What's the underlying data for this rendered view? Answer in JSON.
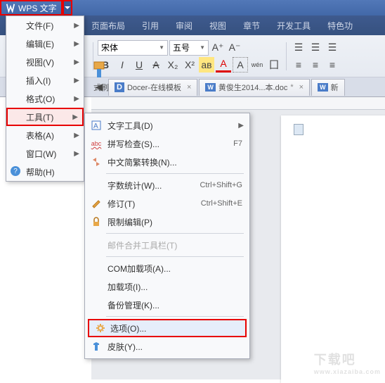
{
  "app": {
    "title": "WPS 文字"
  },
  "tabs": [
    "页面布局",
    "引用",
    "审阅",
    "视图",
    "章节",
    "开发工具",
    "特色功"
  ],
  "toolbar": {
    "brush_label": "式刷",
    "font_name": "宋体",
    "font_size": "五号",
    "bold": "B",
    "italic": "I",
    "underline": "U",
    "strike": "A",
    "sub": "X₂",
    "sup": "X²",
    "ainc": "A⁺",
    "adec": "A⁻",
    "hl": "aʙ",
    "color": "A",
    "char": "A",
    "pinyin": "wén",
    "border": "囗"
  },
  "doctabs": [
    {
      "icon": "D",
      "label": "Docer-在线模板"
    },
    {
      "icon": "W",
      "label": "黄俊生2014...本.doc"
    },
    {
      "icon": "W",
      "label": "新"
    }
  ],
  "menu1": [
    {
      "label": "文件(F)",
      "arrow": true
    },
    {
      "label": "编辑(E)",
      "arrow": true
    },
    {
      "label": "视图(V)",
      "arrow": true
    },
    {
      "label": "插入(I)",
      "arrow": true
    },
    {
      "label": "格式(O)",
      "arrow": true
    },
    {
      "label": "工具(T)",
      "arrow": true,
      "hl": true
    },
    {
      "label": "表格(A)",
      "arrow": true
    },
    {
      "label": "窗口(W)",
      "arrow": true
    },
    {
      "label": "帮助(H)",
      "qicon": true
    }
  ],
  "menu2": {
    "items": [
      {
        "icon": "text-tool-icon",
        "label": "文字工具(D)",
        "arrow": true
      },
      {
        "icon": "spellcheck-icon",
        "glyph": "abc",
        "label": "拼写检查(S)...",
        "shortcut": "F7"
      },
      {
        "icon": "convert-icon",
        "label": "中文简繁转换(N)...",
        "sepAfter": true
      },
      {
        "label": "字数统计(W)...",
        "shortcut": "Ctrl+Shift+G"
      },
      {
        "icon": "revision-icon",
        "label": "修订(T)",
        "shortcut": "Ctrl+Shift+E"
      },
      {
        "icon": "lock-icon",
        "label": "限制编辑(P)",
        "sepAfter": true
      },
      {
        "label": "邮件合并工具栏(T)",
        "disabled": true,
        "sepAfter": true
      },
      {
        "label": "COM加载项(A)..."
      },
      {
        "label": "加载项(I)..."
      },
      {
        "label": "备份管理(K)...",
        "sepAfter": true
      },
      {
        "icon": "gear-icon",
        "label": "选项(O)...",
        "hl": true
      },
      {
        "icon": "skin-icon",
        "label": "皮肤(Y)..."
      }
    ]
  },
  "watermark": {
    "big": "下载吧",
    "small": "www.xiazaiba.com"
  }
}
